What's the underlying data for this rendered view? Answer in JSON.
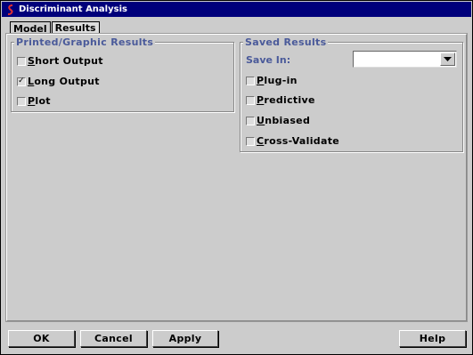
{
  "window": {
    "title": "Discriminant Analysis",
    "app_icon": "s-plus-logo-icon"
  },
  "tabs": [
    {
      "label": "Model",
      "active": true
    },
    {
      "label": "Results",
      "active": false
    }
  ],
  "printed_group": {
    "legend": "Printed/Graphic Results",
    "options": [
      {
        "first": "S",
        "rest": "hort Output",
        "checked": false
      },
      {
        "first": "L",
        "rest": "ong Output",
        "checked": true
      },
      {
        "first": "P",
        "rest": "lot",
        "checked": false
      }
    ]
  },
  "saved_group": {
    "legend": "Saved Results",
    "save_in_label": "Save In:",
    "save_in_value": "",
    "options": [
      {
        "first": "P",
        "rest": "lug-in",
        "checked": false
      },
      {
        "first": "P",
        "rest": "redictive",
        "checked": false
      },
      {
        "first": "U",
        "rest": "nbiased",
        "checked": false
      },
      {
        "first": "C",
        "rest": "ross-Validate",
        "checked": false
      }
    ]
  },
  "buttons": {
    "ok": "OK",
    "cancel": "Cancel",
    "apply": "Apply",
    "help": "Help"
  },
  "colors": {
    "titlebar": "#00007b",
    "legend_text": "#4a5a9a",
    "dialog_bg": "#cccccc"
  }
}
